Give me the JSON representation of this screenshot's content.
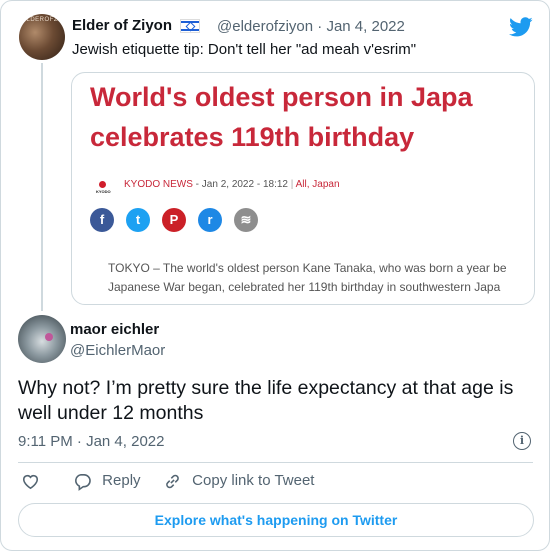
{
  "tweet": {
    "author_name": "Elder of Ziyon",
    "author_handle": "@elderofziyon",
    "date_sep": "·",
    "date": "Jan 4, 2022",
    "avatar_brand": "ELDEROFZ",
    "text": "Jewish etiquette tip: Don't tell her \"ad meah v'esrim\"",
    "embed": {
      "headline_line1": "World's oldest person in Japa",
      "headline_line2": "celebrates 119th birthday",
      "logo_text": "KYODO",
      "source_name": "KYODO NEWS",
      "source_date": " - Jan 2, 2022 - 18:12 ",
      "source_sep": "|",
      "source_section": " All, Japan",
      "share_icons": [
        {
          "name": "facebook-icon",
          "glyph": "f",
          "color": "#3b5998"
        },
        {
          "name": "twitter-icon",
          "glyph": "t",
          "color": "#1da1f2"
        },
        {
          "name": "pinterest-icon",
          "glyph": "P",
          "color": "#cb2027"
        },
        {
          "name": "reddit-icon",
          "glyph": "r",
          "color": "#1e88e5"
        },
        {
          "name": "rss-icon",
          "glyph": "≋",
          "color": "#8e8e8e"
        }
      ],
      "excerpt_line1": "TOKYO – The world's oldest person Kane Tanaka, who was born a year be",
      "excerpt_line2": "Japanese War began, celebrated her 119th birthday in southwestern Japa"
    }
  },
  "reply": {
    "author_name": "maor eichler",
    "author_handle": "@EichlerMaor",
    "text": "Why not? I’m pretty sure the life expectancy at that age is well under 12 months",
    "timestamp": "9:11 PM · Jan 4, 2022"
  },
  "actions": {
    "reply_label": "Reply",
    "copy_label": "Copy link to Tweet"
  },
  "explore_label": "Explore what's happening on Twitter",
  "colors": {
    "accent": "#1d9bf0",
    "headline_red": "#c8283a",
    "muted": "#536471"
  }
}
